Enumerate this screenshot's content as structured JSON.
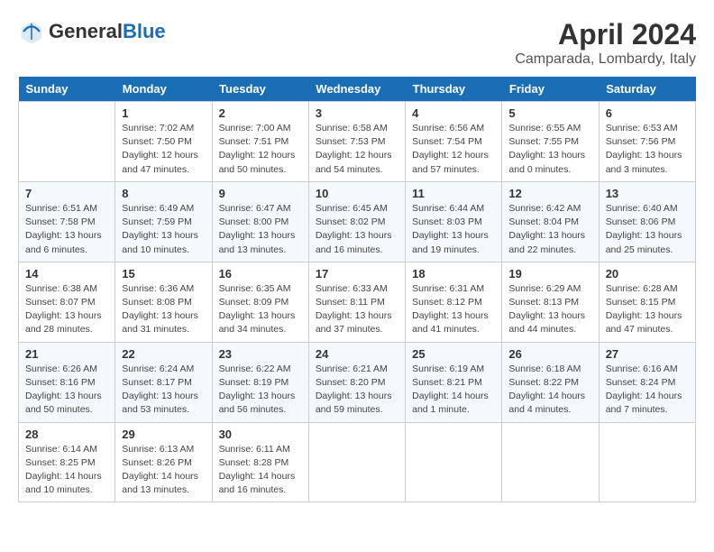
{
  "header": {
    "logo_line1": "General",
    "logo_line2": "Blue",
    "month": "April 2024",
    "location": "Camparada, Lombardy, Italy"
  },
  "weekdays": [
    "Sunday",
    "Monday",
    "Tuesday",
    "Wednesday",
    "Thursday",
    "Friday",
    "Saturday"
  ],
  "weeks": [
    [
      {
        "day": "",
        "info": ""
      },
      {
        "day": "1",
        "info": "Sunrise: 7:02 AM\nSunset: 7:50 PM\nDaylight: 12 hours\nand 47 minutes."
      },
      {
        "day": "2",
        "info": "Sunrise: 7:00 AM\nSunset: 7:51 PM\nDaylight: 12 hours\nand 50 minutes."
      },
      {
        "day": "3",
        "info": "Sunrise: 6:58 AM\nSunset: 7:53 PM\nDaylight: 12 hours\nand 54 minutes."
      },
      {
        "day": "4",
        "info": "Sunrise: 6:56 AM\nSunset: 7:54 PM\nDaylight: 12 hours\nand 57 minutes."
      },
      {
        "day": "5",
        "info": "Sunrise: 6:55 AM\nSunset: 7:55 PM\nDaylight: 13 hours\nand 0 minutes."
      },
      {
        "day": "6",
        "info": "Sunrise: 6:53 AM\nSunset: 7:56 PM\nDaylight: 13 hours\nand 3 minutes."
      }
    ],
    [
      {
        "day": "7",
        "info": "Sunrise: 6:51 AM\nSunset: 7:58 PM\nDaylight: 13 hours\nand 6 minutes."
      },
      {
        "day": "8",
        "info": "Sunrise: 6:49 AM\nSunset: 7:59 PM\nDaylight: 13 hours\nand 10 minutes."
      },
      {
        "day": "9",
        "info": "Sunrise: 6:47 AM\nSunset: 8:00 PM\nDaylight: 13 hours\nand 13 minutes."
      },
      {
        "day": "10",
        "info": "Sunrise: 6:45 AM\nSunset: 8:02 PM\nDaylight: 13 hours\nand 16 minutes."
      },
      {
        "day": "11",
        "info": "Sunrise: 6:44 AM\nSunset: 8:03 PM\nDaylight: 13 hours\nand 19 minutes."
      },
      {
        "day": "12",
        "info": "Sunrise: 6:42 AM\nSunset: 8:04 PM\nDaylight: 13 hours\nand 22 minutes."
      },
      {
        "day": "13",
        "info": "Sunrise: 6:40 AM\nSunset: 8:06 PM\nDaylight: 13 hours\nand 25 minutes."
      }
    ],
    [
      {
        "day": "14",
        "info": "Sunrise: 6:38 AM\nSunset: 8:07 PM\nDaylight: 13 hours\nand 28 minutes."
      },
      {
        "day": "15",
        "info": "Sunrise: 6:36 AM\nSunset: 8:08 PM\nDaylight: 13 hours\nand 31 minutes."
      },
      {
        "day": "16",
        "info": "Sunrise: 6:35 AM\nSunset: 8:09 PM\nDaylight: 13 hours\nand 34 minutes."
      },
      {
        "day": "17",
        "info": "Sunrise: 6:33 AM\nSunset: 8:11 PM\nDaylight: 13 hours\nand 37 minutes."
      },
      {
        "day": "18",
        "info": "Sunrise: 6:31 AM\nSunset: 8:12 PM\nDaylight: 13 hours\nand 41 minutes."
      },
      {
        "day": "19",
        "info": "Sunrise: 6:29 AM\nSunset: 8:13 PM\nDaylight: 13 hours\nand 44 minutes."
      },
      {
        "day": "20",
        "info": "Sunrise: 6:28 AM\nSunset: 8:15 PM\nDaylight: 13 hours\nand 47 minutes."
      }
    ],
    [
      {
        "day": "21",
        "info": "Sunrise: 6:26 AM\nSunset: 8:16 PM\nDaylight: 13 hours\nand 50 minutes."
      },
      {
        "day": "22",
        "info": "Sunrise: 6:24 AM\nSunset: 8:17 PM\nDaylight: 13 hours\nand 53 minutes."
      },
      {
        "day": "23",
        "info": "Sunrise: 6:22 AM\nSunset: 8:19 PM\nDaylight: 13 hours\nand 56 minutes."
      },
      {
        "day": "24",
        "info": "Sunrise: 6:21 AM\nSunset: 8:20 PM\nDaylight: 13 hours\nand 59 minutes."
      },
      {
        "day": "25",
        "info": "Sunrise: 6:19 AM\nSunset: 8:21 PM\nDaylight: 14 hours\nand 1 minute."
      },
      {
        "day": "26",
        "info": "Sunrise: 6:18 AM\nSunset: 8:22 PM\nDaylight: 14 hours\nand 4 minutes."
      },
      {
        "day": "27",
        "info": "Sunrise: 6:16 AM\nSunset: 8:24 PM\nDaylight: 14 hours\nand 7 minutes."
      }
    ],
    [
      {
        "day": "28",
        "info": "Sunrise: 6:14 AM\nSunset: 8:25 PM\nDaylight: 14 hours\nand 10 minutes."
      },
      {
        "day": "29",
        "info": "Sunrise: 6:13 AM\nSunset: 8:26 PM\nDaylight: 14 hours\nand 13 minutes."
      },
      {
        "day": "30",
        "info": "Sunrise: 6:11 AM\nSunset: 8:28 PM\nDaylight: 14 hours\nand 16 minutes."
      },
      {
        "day": "",
        "info": ""
      },
      {
        "day": "",
        "info": ""
      },
      {
        "day": "",
        "info": ""
      },
      {
        "day": "",
        "info": ""
      }
    ]
  ]
}
